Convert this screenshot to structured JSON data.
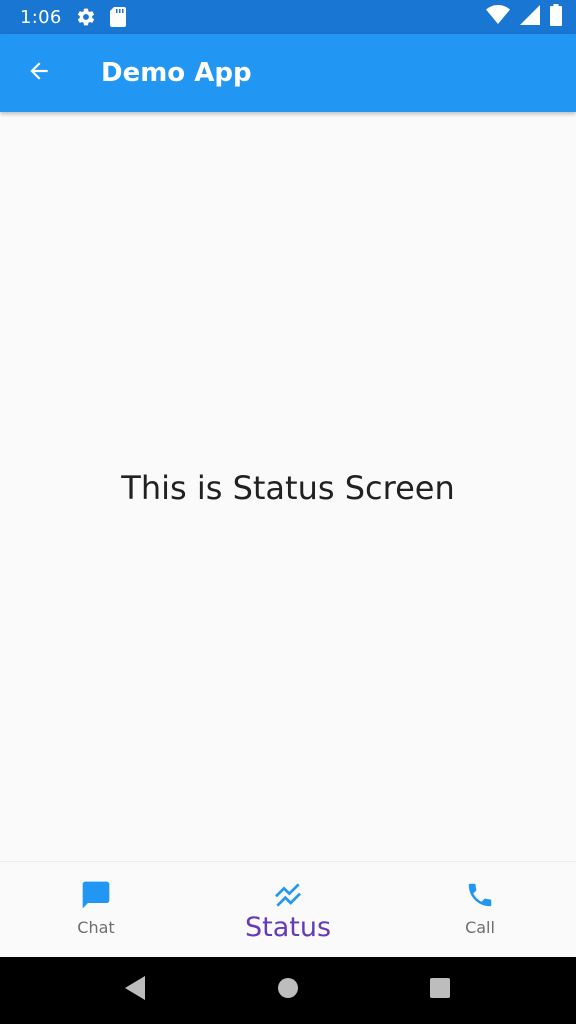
{
  "status_bar": {
    "time": "1:06",
    "icons": [
      "settings-icon",
      "sd-card-icon",
      "wifi-icon",
      "signal-icon",
      "battery-icon"
    ]
  },
  "app_bar": {
    "title": "Demo App",
    "back_icon": "arrow-back-icon"
  },
  "main": {
    "text": "This is Status Screen"
  },
  "bottom_nav": {
    "items": [
      {
        "label": "Chat",
        "icon": "chat-icon",
        "active": false
      },
      {
        "label": "Status",
        "icon": "trending-icon",
        "active": true
      },
      {
        "label": "Call",
        "icon": "phone-icon",
        "active": false
      }
    ]
  },
  "system_nav": {
    "buttons": [
      "back-triangle-icon",
      "home-circle-icon",
      "recents-square-icon"
    ]
  },
  "colors": {
    "status_bar": "#1976d2",
    "app_bar": "#2196f3",
    "nav_icon": "#2196f3",
    "active_label": "#673ab7",
    "inactive_label": "#6e6e6e",
    "background": "#fafafa"
  }
}
